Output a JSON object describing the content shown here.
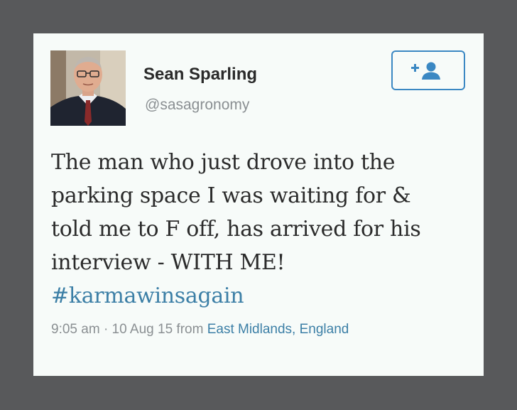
{
  "user": {
    "name": "Sean Sparling",
    "handle": "@sasagronomy"
  },
  "follow_button": {
    "icon": "add-user-icon",
    "color": "#3b88c3"
  },
  "tweet": {
    "lines": [
      "The man who just drove into the",
      "parking space I was waiting for &",
      "told me to F off, has arrived for his",
      "interview - WITH ME!"
    ],
    "hashtag": "#karmawinsagain"
  },
  "meta": {
    "time": "9:05 am",
    "separator": "·",
    "date": "10 Aug 15",
    "from_label": "from",
    "location": "East Midlands, England"
  },
  "colors": {
    "link": "#3c7fa6",
    "background": "#58595b",
    "card": "#f7fbf9"
  }
}
